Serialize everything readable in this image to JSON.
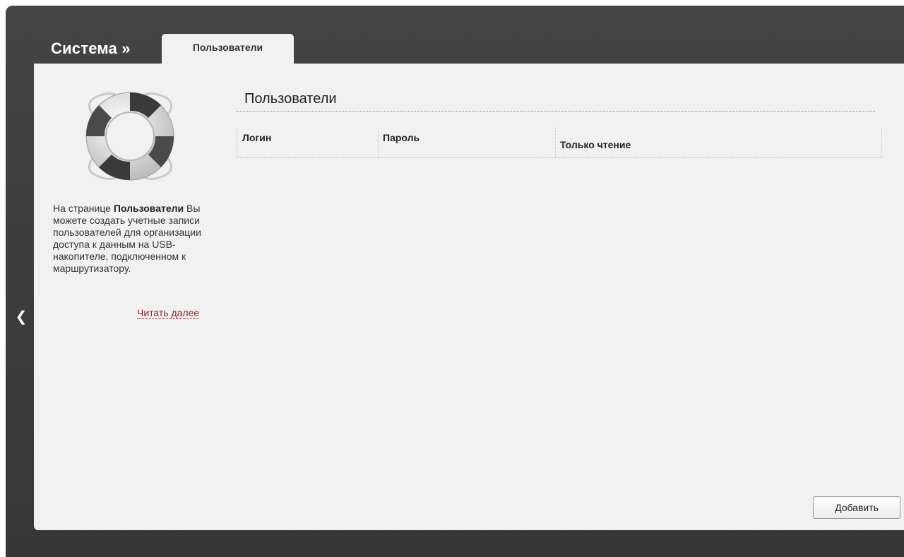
{
  "header": {
    "section_title": "Система »",
    "active_tab": "Пользователи"
  },
  "help": {
    "text_prefix": "На странице ",
    "text_bold": "Пользователи",
    "text_rest": " Вы можете создать учетные записи пользователей для организации доступа к данным на USB-накопителе, подключенном к маршрутизатору.",
    "read_more": "Читать далее",
    "icon": "lifebuoy-icon"
  },
  "main": {
    "title": "Пользователи",
    "table": {
      "columns": [
        "Логин",
        "Пароль",
        "Только чтение"
      ],
      "rows": []
    },
    "add_button": "Добавить"
  },
  "nav": {
    "collapse_icon": "chevron-left-icon"
  },
  "colors": {
    "frame": "#3c3c3c",
    "panel": "#f1f1f1",
    "link": "#9b1b1b"
  }
}
